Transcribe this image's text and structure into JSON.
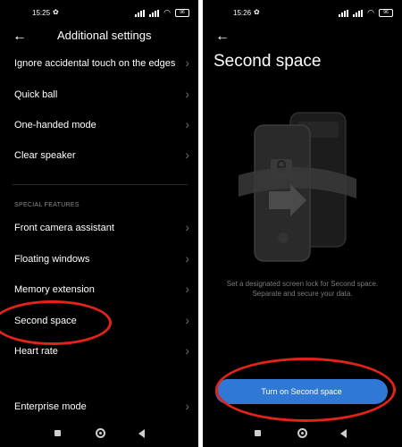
{
  "left": {
    "status": {
      "time": "15:25",
      "battery": "96"
    },
    "header": {
      "title": "Additional settings"
    },
    "items_top": [
      {
        "label": "Ignore accidental touch on the edges"
      },
      {
        "label": "Quick ball"
      },
      {
        "label": "One-handed mode"
      },
      {
        "label": "Clear speaker"
      }
    ],
    "section_label": "SPECIAL FEATURES",
    "items_special": [
      {
        "label": "Front camera assistant"
      },
      {
        "label": "Floating windows"
      },
      {
        "label": "Memory extension"
      },
      {
        "label": "Second space"
      },
      {
        "label": "Heart rate"
      }
    ],
    "item_bottom": {
      "label": "Enterprise mode"
    }
  },
  "right": {
    "status": {
      "time": "15:26",
      "battery": "96"
    },
    "title": "Second space",
    "description_line1": "Set a designated screen lock for Second space.",
    "description_line2": "Separate and secure your data.",
    "button_label": "Turn on Second space"
  },
  "colors": {
    "background": "#000000",
    "accent": "#2f78d6",
    "annotation": "#e2231a"
  },
  "icons": {
    "back": "back-arrow-icon",
    "chevron": "chevron-right-icon",
    "illustration": "dual-phone-illustration"
  }
}
